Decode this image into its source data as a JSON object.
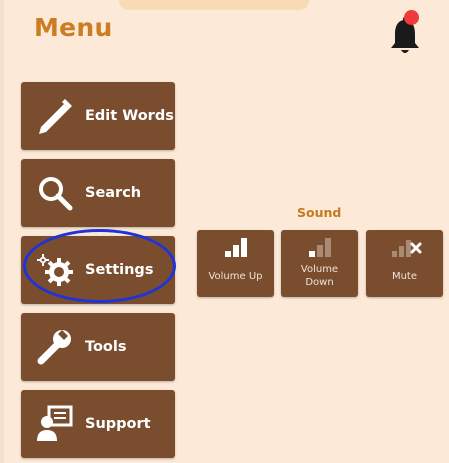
{
  "menu": {
    "title": "Menu",
    "items": [
      {
        "label": "Edit Words",
        "icon": "pencil-icon"
      },
      {
        "label": "Search",
        "icon": "search-icon"
      },
      {
        "label": "Settings",
        "icon": "gear-icon"
      },
      {
        "label": "Tools",
        "icon": "wrench-icon"
      },
      {
        "label": "Support",
        "icon": "support-icon"
      }
    ]
  },
  "notifications": {
    "icon": "bell-icon",
    "badge": "red-dot"
  },
  "sound": {
    "title": "Sound",
    "buttons": [
      {
        "label": "Volume Up",
        "icon": "volume-up-icon"
      },
      {
        "label": "Volume Down",
        "icon": "volume-down-icon"
      },
      {
        "label": "Mute",
        "icon": "mute-icon"
      }
    ]
  },
  "colors": {
    "background": "#fce9d7",
    "button": "#7b4d2f",
    "title": "#cc7d24",
    "highlight": "#1f33d6",
    "badge": "#ef3b3b"
  }
}
